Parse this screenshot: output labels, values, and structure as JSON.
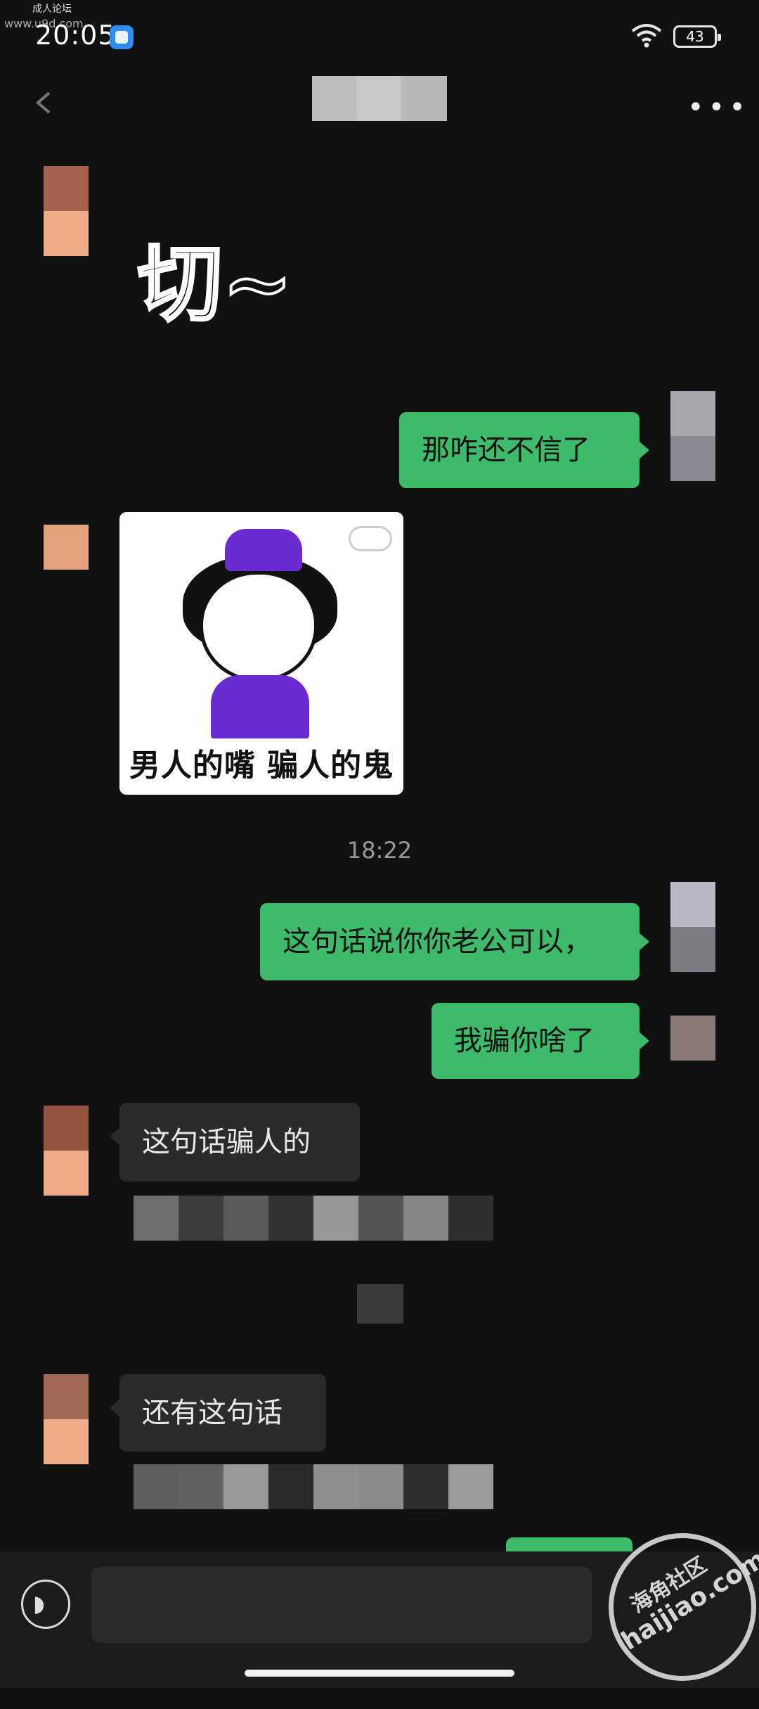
{
  "watermark": {
    "top_label": "成人论坛",
    "top_url": "www.u9d.com",
    "stamp_cn": "海角社区",
    "stamp_url": "haijiao.com"
  },
  "status_bar": {
    "time": "20:05",
    "battery": "43"
  },
  "header": {
    "more_label": "•••"
  },
  "messages": [
    {
      "side": "left",
      "type": "sticker",
      "text": "切~"
    },
    {
      "side": "right",
      "type": "text",
      "text": "那咋还不信了"
    },
    {
      "side": "left",
      "type": "image",
      "caption": "男人的嘴 骗人的鬼"
    },
    {
      "type": "timestamp",
      "text": "18:22"
    },
    {
      "side": "right",
      "type": "text",
      "text": "这句话说你你老公可以，"
    },
    {
      "side": "right",
      "type": "text",
      "text": "我骗你啥了"
    },
    {
      "side": "left",
      "type": "text",
      "text": "这句话骗人的"
    },
    {
      "side": "left",
      "type": "text",
      "text": "还有这句话"
    }
  ],
  "colors": {
    "accent": "#3dbb6b",
    "background": "#111111",
    "bubble_gray": "#2b2b2b"
  },
  "icons": {
    "back": "back-arrow-icon",
    "more": "more-dots-icon",
    "voice": "voice-input-icon",
    "wifi": "wifi-icon"
  }
}
